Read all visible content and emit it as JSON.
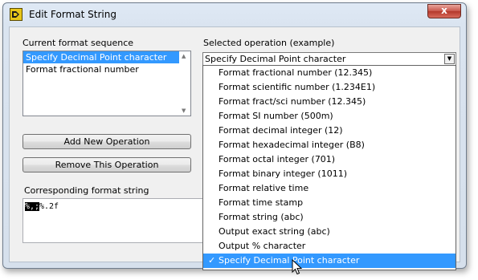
{
  "window": {
    "title": "Edit Format String",
    "close_label": "x"
  },
  "sequence": {
    "label": "Current format sequence",
    "items": [
      {
        "label": "Specify Decimal Point character",
        "selected": true
      },
      {
        "label": "Format fractional number",
        "selected": false
      }
    ]
  },
  "buttons": {
    "add": "Add New Operation",
    "remove": "Remove This Operation"
  },
  "format": {
    "label": "Corresponding format string",
    "value_selected": "%,;",
    "value_rest": "%.2f"
  },
  "operation": {
    "label": "Selected operation (example)",
    "value": "Specify Decimal Point character",
    "options": [
      "Format fractional number (12.345)",
      "Format scientific number (1.234E1)",
      "Format fract/sci number (12.345)",
      "Format SI number (500m)",
      "Format decimal integer (12)",
      "Format hexadecimal integer (B8)",
      "Format octal integer (701)",
      "Format binary integer (1011)",
      "Format relative time",
      "Format time stamp",
      "Format string (abc)",
      "Output exact string (abc)",
      "Output % character",
      "Specify Decimal Point character"
    ],
    "selected_index": 13,
    "check_mark": "✓"
  },
  "colors": {
    "selection": "#3399ff",
    "window_frame": "#dae4f0"
  },
  "icons": {
    "app": "labview-icon",
    "dropdown": "chevron-down-icon",
    "cursor": "mouse-pointer-icon"
  }
}
